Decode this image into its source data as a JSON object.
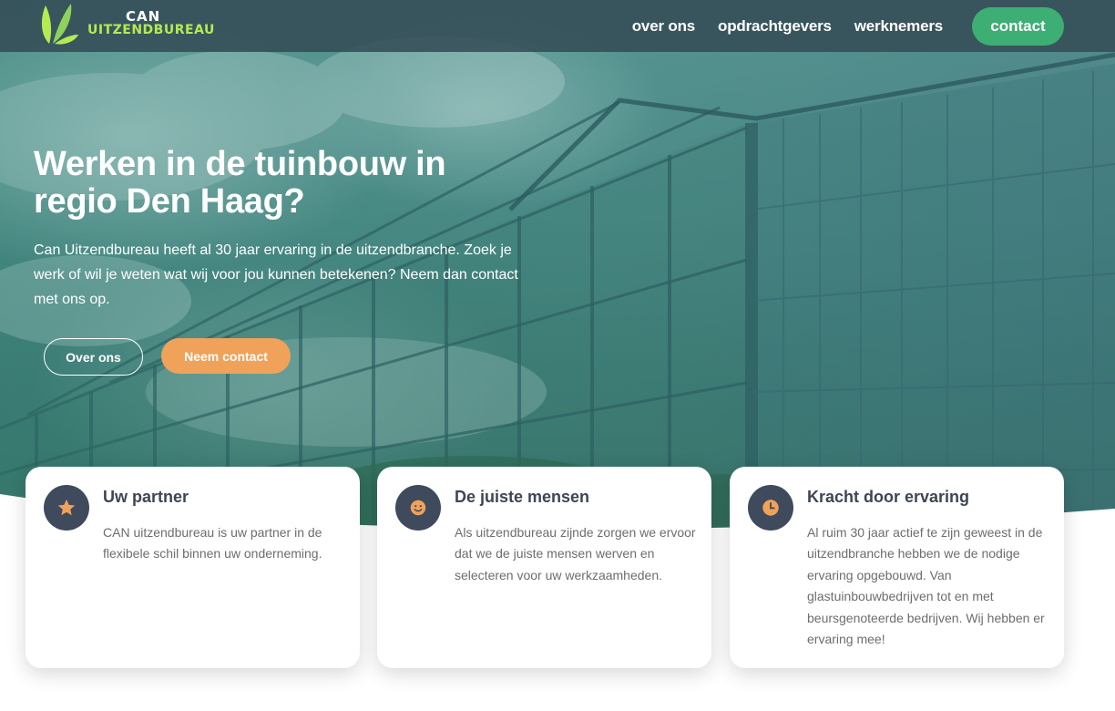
{
  "header": {
    "logo": {
      "line1": "CAN",
      "line2": "UITZENDBUREAU"
    },
    "nav": [
      {
        "label": "over ons"
      },
      {
        "label": "opdrachtgevers"
      },
      {
        "label": "werknemers"
      }
    ],
    "contact_label": "contact"
  },
  "hero": {
    "title": "Werken in de tuinbouw in regio Den Haag?",
    "text": "Can Uitzendbureau heeft al 30 jaar ervaring in de uitzendbranche. Zoek je werk of wil je weten wat wij voor jou kunnen betekenen? Neem dan contact met ons op.",
    "btn_over_ons": "Over ons",
    "btn_contact": "Neem contact"
  },
  "cards": [
    {
      "icon": "star-icon",
      "title": "Uw partner",
      "text": "CAN uitzendbureau is uw partner in de flexibele schil binnen uw onderneming."
    },
    {
      "icon": "smiley-icon",
      "title": "De juiste mensen",
      "text": "Als uitzendbureau zijnde zorgen we ervoor dat we de juiste mensen werven en selecteren voor uw werkzaamheden."
    },
    {
      "icon": "clock-icon",
      "title": "Kracht door ervaring",
      "text": "Al ruim 30 jaar actief te zijn geweest in de uitzendbranche hebben we de nodige ervaring opgebouwd. Van glastuinbouwbedrijven tot en met beursgenoteerde bedrijven. Wij hebben er ervaring mee!"
    }
  ],
  "colors": {
    "header_bg": "#344c56",
    "accent_green": "#3dae74",
    "logo_green": "#b6ea52",
    "accent_orange": "#f0a25a",
    "icon_bg": "#3f4a5c",
    "card_title": "#3e4654",
    "card_text": "#6d6d6d"
  }
}
